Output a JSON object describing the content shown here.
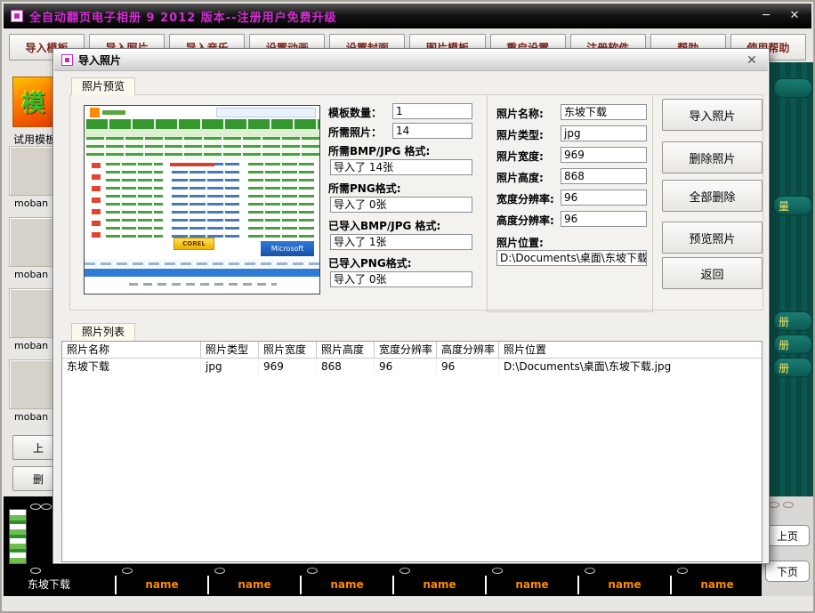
{
  "window": {
    "title": "全自动翻页电子相册 9 2012 版本--注册用户免费升级",
    "minimize": "─",
    "close": "✕"
  },
  "toolbar": {
    "buttons": [
      "导入模板",
      "导入照片",
      "导入音乐",
      "设置动画",
      "设置封面",
      "图片模板",
      "重启设置",
      "注册软件",
      "帮助",
      "使用帮助"
    ]
  },
  "left_panel": {
    "template_char": "模",
    "trial_label": "试用模板",
    "items": [
      "moban",
      "moban",
      "moban",
      "moban"
    ],
    "up_button": "上",
    "delete_button": "删"
  },
  "right_panel": {
    "fragments": [
      "量",
      "册",
      "册",
      "册"
    ],
    "prev_page": "上页",
    "next_page": "下页"
  },
  "bottom_strip": {
    "cells": [
      "东坡下载",
      "name",
      "name",
      "name",
      "name",
      "name",
      "name",
      "name"
    ]
  },
  "dialog": {
    "title": "导入照片",
    "close": "✕",
    "tabs": {
      "preview": "照片预览",
      "list": "照片列表"
    },
    "stats": {
      "template_count_label": "模板数量：",
      "template_count": "1",
      "needed_photos_label": "所需照片：",
      "needed_photos": "14",
      "needed_bmpjpg_label": "所需BMP/JPG 格式:",
      "needed_bmpjpg": "导入了 14张",
      "needed_png_label": "所需PNG格式:",
      "needed_png": "导入了 0张",
      "imported_bmpjpg_label": "已导入BMP/JPG 格式:",
      "imported_bmpjpg": "导入了 1张",
      "imported_png_label": "已导入PNG格式:",
      "imported_png": "导入了 0张"
    },
    "photo_info": {
      "name_label": "照片名称:",
      "name_value": "东坡下载",
      "type_label": "照片类型:",
      "type_value": "jpg",
      "width_label": "照片宽度:",
      "width_value": "969",
      "height_label": "照片高度:",
      "height_value": "868",
      "xres_label": "宽度分辨率:",
      "xres_value": "96",
      "yres_label": "高度分辨率:",
      "yres_value": "96",
      "location_label": "照片位置:",
      "location_value": "D:\\Documents\\桌面\\东坡下载"
    },
    "buttons": [
      "导入照片",
      "删除照片",
      "全部删除",
      "预览照片",
      "返回"
    ],
    "table": {
      "headers": [
        "照片名称",
        "照片类型",
        "照片宽度",
        "照片高度",
        "宽度分辨率",
        "高度分辨率",
        "照片位置"
      ],
      "rows": [
        [
          "东坡下载",
          "jpg",
          "969",
          "868",
          "96",
          "96",
          "D:\\Documents\\桌面\\东坡下载.jpg"
        ]
      ]
    },
    "preview": {
      "banner_corel": "COREL",
      "banner_microsoft": "Microsoft"
    }
  },
  "colors": {
    "title_text": "#d42bd4",
    "toolbar_text": "#7c241c",
    "name_text": "#ff8a00",
    "teal_bg": "#0c4f45",
    "pill_text": "#ffe95e"
  }
}
